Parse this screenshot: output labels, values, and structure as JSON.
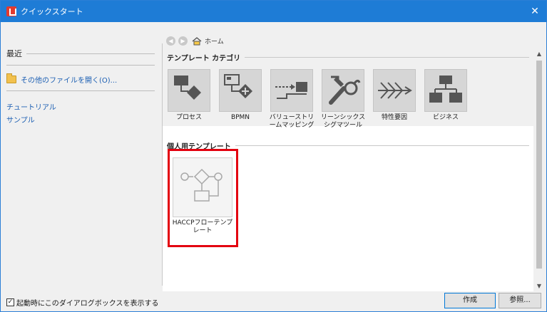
{
  "window": {
    "title": "クイックスタート",
    "close": "✕",
    "accent": "#1e7cd6"
  },
  "sidebar": {
    "recent_label": "最近",
    "open_other": "その他のファイルを開く(O)...",
    "links": [
      "チュートリアル",
      "サンプル"
    ]
  },
  "nav": {
    "back_icon": "back-arrow-icon",
    "forward_icon": "forward-arrow-icon",
    "home_label": "ホーム"
  },
  "categories": {
    "label": "テンプレート カテゴリ",
    "items": [
      {
        "label": "プロセス"
      },
      {
        "label": "BPMN"
      },
      {
        "label": "バリューストリームマッピング"
      },
      {
        "label": "リーンシックスシグマツール"
      },
      {
        "label": "特性要因"
      },
      {
        "label": "ビジネス"
      }
    ]
  },
  "personal": {
    "label": "個人用テンプレート",
    "items": [
      {
        "label": "HACCPフローテンプレート"
      }
    ]
  },
  "footer": {
    "show_on_startup": "起動時にこのダイアログボックスを表示する",
    "checked": true,
    "create_button": "作成",
    "browse_button": "参照..."
  },
  "colors": {
    "highlight": "#e3000f",
    "tile": "#d6d6d6",
    "link": "#1c5fb3"
  }
}
